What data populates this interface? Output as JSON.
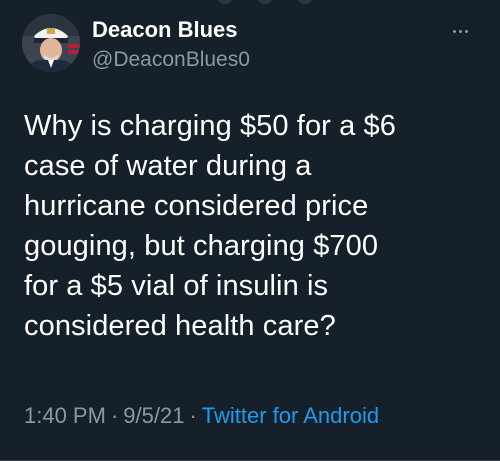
{
  "author": {
    "display_name": "Deacon Blues",
    "handle": "@DeaconBlues0"
  },
  "tweet": {
    "lines": [
      "Why is charging $50 for a $6",
      "case of water during a",
      "hurricane considered price",
      "gouging, but charging $700",
      "for a $5 vial of insulin is",
      "considered health care?"
    ],
    "time": "1:40 PM",
    "separator": "·",
    "date": "9/5/21",
    "source": "Twitter for Android"
  },
  "icons": {
    "more": "more-horizontal-icon",
    "avatar": "avatar-image"
  },
  "colors": {
    "background": "#15202b",
    "text_primary": "#ffffff",
    "text_secondary": "#8b98a5",
    "accent": "#1d9bf0"
  }
}
